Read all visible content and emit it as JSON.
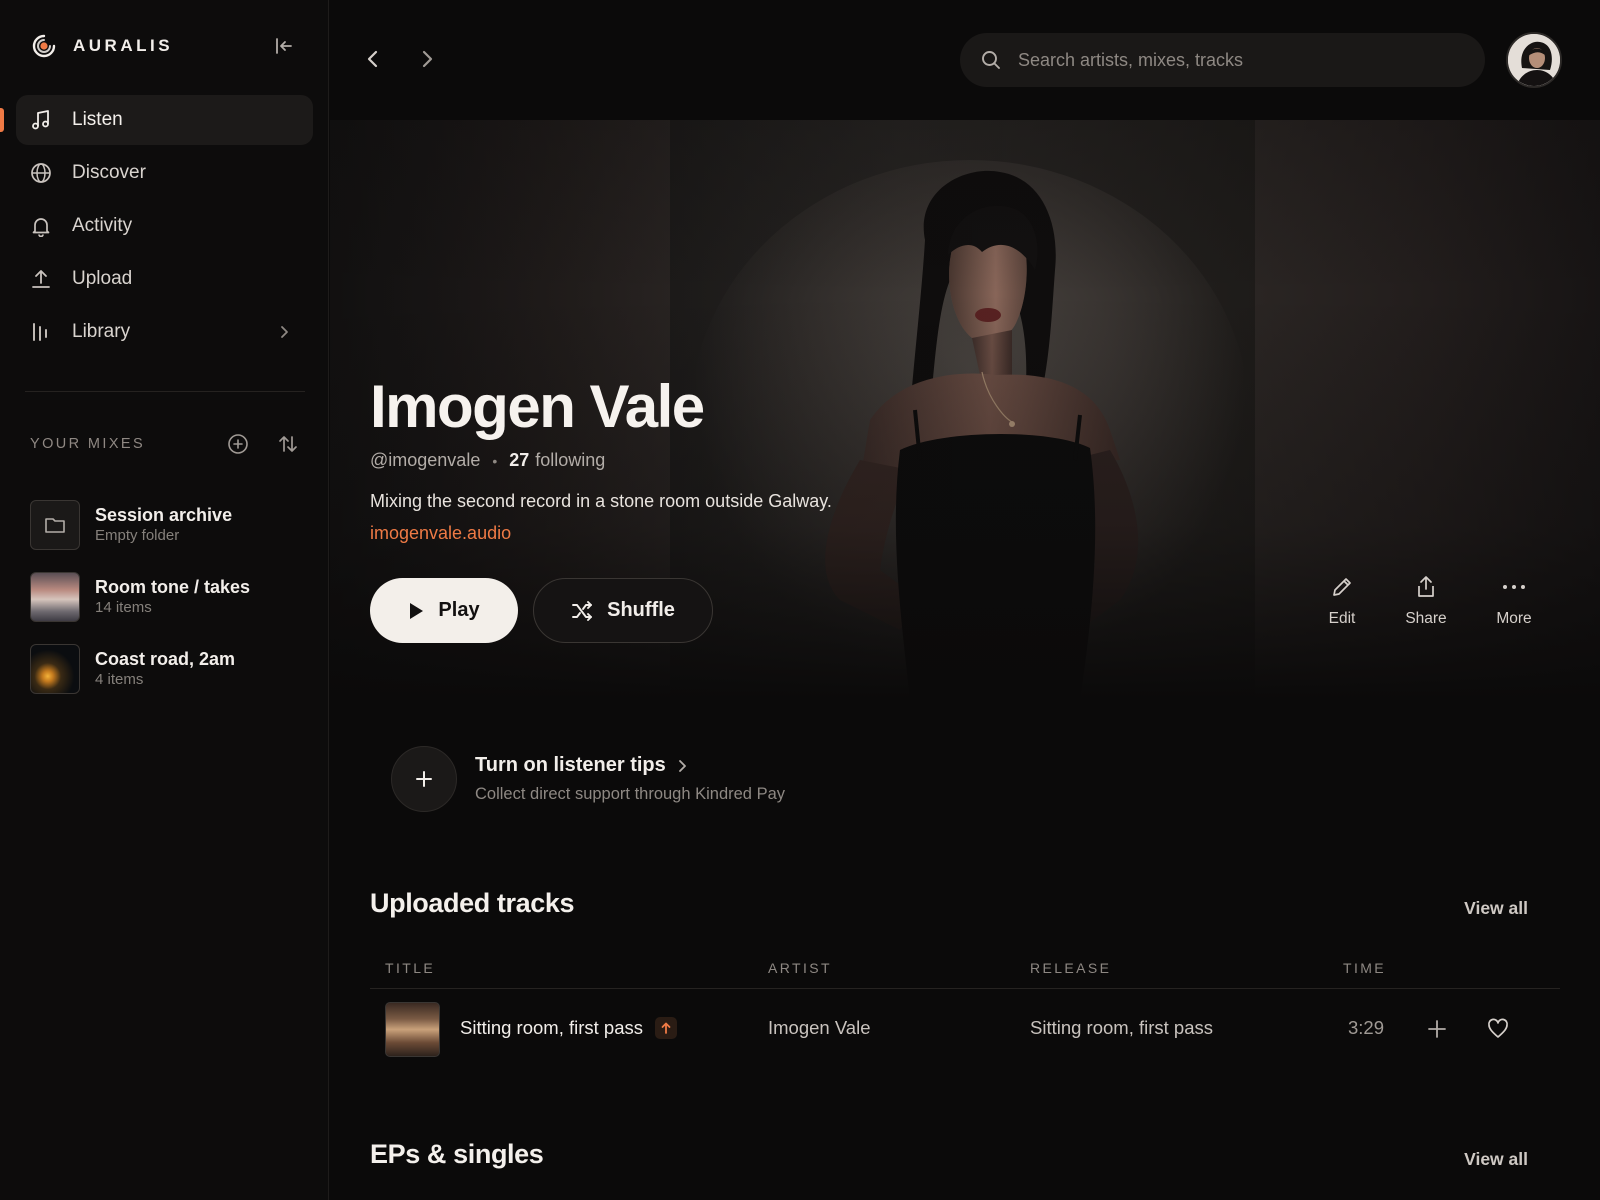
{
  "brand": {
    "name": "AURALIS",
    "accent": "#ef7a45"
  },
  "nav": {
    "items": [
      {
        "label": "Listen",
        "icon": "music-note-icon",
        "active": true
      },
      {
        "label": "Discover",
        "icon": "globe-icon",
        "active": false
      },
      {
        "label": "Activity",
        "icon": "bell-icon",
        "active": false
      },
      {
        "label": "Upload",
        "icon": "upload-icon",
        "active": false
      },
      {
        "label": "Library",
        "icon": "library-icon",
        "active": false
      }
    ]
  },
  "mixes": {
    "title": "YOUR MIXES",
    "items": [
      {
        "name": "Session archive",
        "sub": "Empty folder"
      },
      {
        "name": "Room tone / takes",
        "sub": "14 items"
      },
      {
        "name": "Coast road, 2am",
        "sub": "4 items"
      }
    ]
  },
  "search": {
    "placeholder": "Search artists, mixes, tracks",
    "value": ""
  },
  "profile": {
    "name": "Imogen Vale",
    "handle": "@imogenvale",
    "following_count": "27",
    "following_label": "following",
    "bio": "Mixing the second record in a stone room outside Galway.",
    "link": "imogenvale.audio"
  },
  "actions": {
    "play": "Play",
    "shuffle": "Shuffle",
    "edit": "Edit",
    "share": "Share",
    "more": "More"
  },
  "tips": {
    "title": "Turn on listener tips",
    "subtitle": "Collect direct support through Kindred Pay"
  },
  "uploaded": {
    "title": "Uploaded tracks",
    "view_all": "View all",
    "columns": {
      "title": "TITLE",
      "artist": "ARTIST",
      "release": "RELEASE",
      "time": "TIME"
    },
    "rows": [
      {
        "title": "Sitting room, first pass",
        "artist": "Imogen Vale",
        "release": "Sitting room, first pass",
        "time": "3:29"
      }
    ]
  },
  "eps": {
    "title": "EPs & singles",
    "view_all": "View all"
  }
}
